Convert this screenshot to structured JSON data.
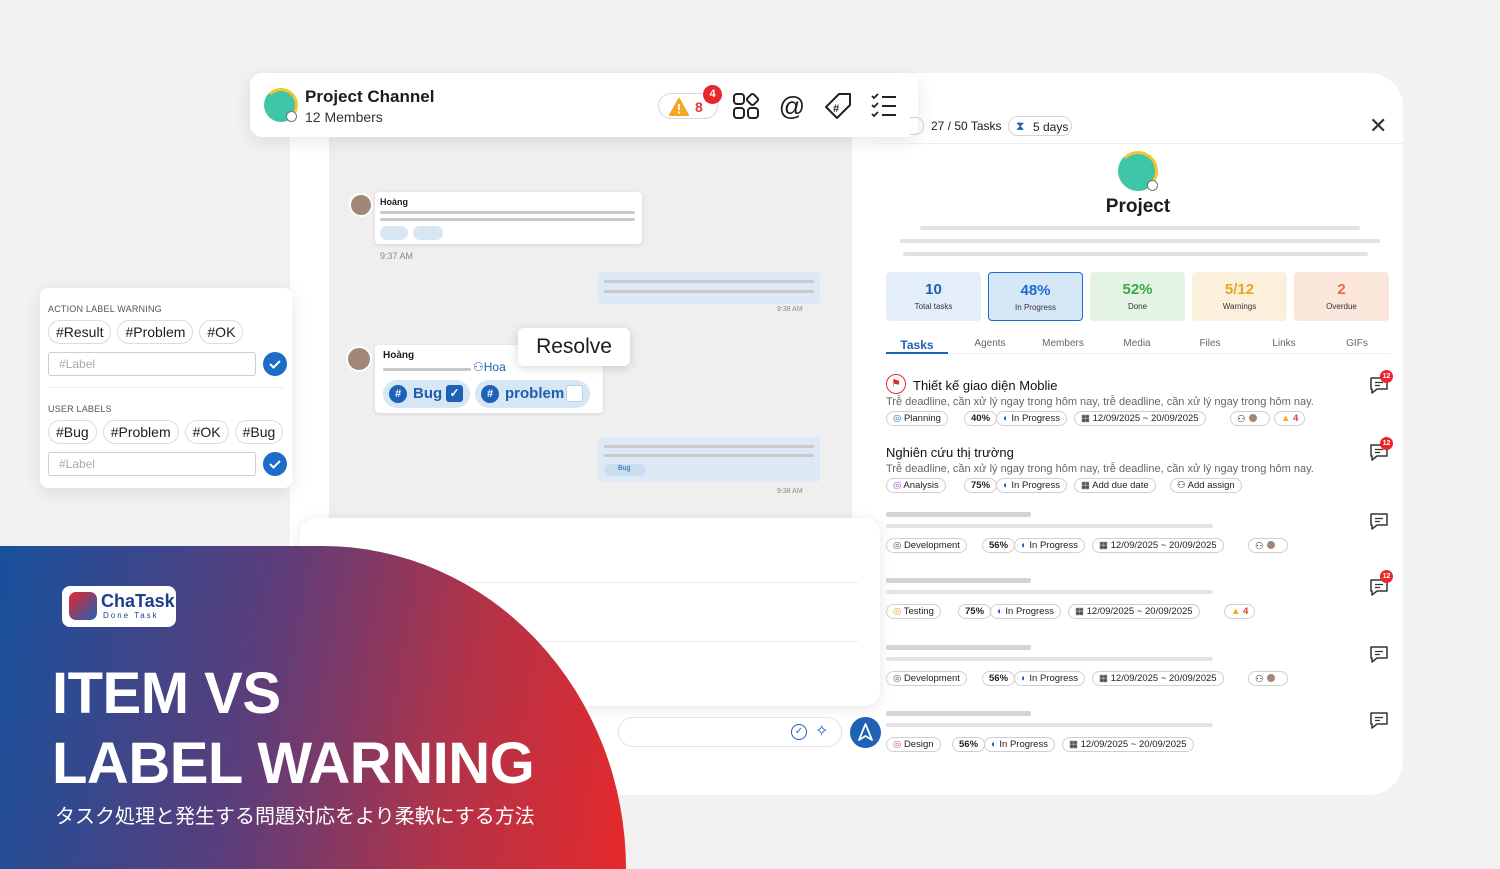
{
  "header": {
    "title": "Project Channel",
    "members": "12 Members",
    "warning_count": "8",
    "warning_badge": "4"
  },
  "chat": {
    "msg1": {
      "sender": "Hoàng",
      "time": "9:37 AM"
    },
    "msg2_time": "9:38 AM",
    "msg3": {
      "sender": "Hoàng",
      "mention": "Hoa",
      "tag1": "Bug",
      "tag2": "problem"
    },
    "msg4": {
      "tag": "Bug",
      "time": "9:38 AM"
    },
    "resolve_tooltip": "Resolve"
  },
  "labels_card": {
    "action_title": "ACTION LABEL WARNING",
    "action_chips": [
      "#Result",
      "#Problem",
      "#OK"
    ],
    "input_placeholder": "#Label",
    "user_title": "USER LABELS",
    "user_chips": [
      "#Bug",
      "#Problem",
      "#OK",
      "#Bug"
    ]
  },
  "project": {
    "tasks_progress": "27 / 50 Tasks",
    "days": "5 days",
    "name": "Project",
    "stats": [
      {
        "value": "10",
        "label": "Total tasks",
        "color": "#1d5fae",
        "bg": "#e3eef9"
      },
      {
        "value": "48%",
        "label": "In Progress",
        "color": "#1d6cc7",
        "bg": "#d6e7f8"
      },
      {
        "value": "52%",
        "label": "Done",
        "color": "#3aa84a",
        "bg": "#e4f4e4"
      },
      {
        "value": "5/12",
        "label": "Warnings",
        "color": "#e9a425",
        "bg": "#fbf0dc"
      },
      {
        "value": "2",
        "label": "Overdue",
        "color": "#ef6b3a",
        "bg": "#fbe6dc"
      }
    ],
    "tabs": [
      "Tasks",
      "Agents",
      "Members",
      "Media",
      "Files",
      "Links",
      "GIFs"
    ],
    "tasks": [
      {
        "title": "Thiết kế giao diện Moblie",
        "desc": "Trễ deadline, cần xử lý ngay trong hôm nay, trễ deadline, cần xử lý ngay trong hôm nay.",
        "category": "Planning",
        "percent": "40%",
        "status": "In Progress",
        "date": "12/09/2025 ~ 20/09/2025",
        "warn": "4",
        "badge": "12"
      },
      {
        "title": "Nghiên cứu thị trường",
        "desc": "Trễ deadline, cần xử lý ngay trong hôm nay, trễ deadline, cần xử lý ngay trong hôm nay.",
        "category": "Analysis",
        "percent": "75%",
        "status": "In Progress",
        "date": "Add due date",
        "assign": "Add assign",
        "badge": "12"
      },
      {
        "category": "Development",
        "percent": "56%",
        "status": "In Progress",
        "date": "12/09/2025 ~ 20/09/2025"
      },
      {
        "category": "Testing",
        "percent": "75%",
        "status": "In Progress",
        "date": "12/09/2025 ~ 20/09/2025",
        "warn": "4",
        "badge": "12"
      },
      {
        "category": "Development",
        "percent": "56%",
        "status": "In Progress",
        "date": "12/09/2025 ~ 20/09/2025"
      },
      {
        "category": "Design",
        "percent": "56%",
        "status": "In Progress",
        "date": "12/09/2025 ~ 20/09/2025"
      }
    ]
  },
  "banner": {
    "logo_name": "ChaTask",
    "logo_tagline": "Done Task",
    "line1": "ITEM VS",
    "line2": "LABEL WARNING",
    "subtitle": "タスク処理と発生する問題対応をより柔軟にする方法"
  },
  "colors": {
    "brand_blue": "#1d62b5",
    "alert_red": "#e8262b",
    "warn_orange": "#f5a623"
  }
}
